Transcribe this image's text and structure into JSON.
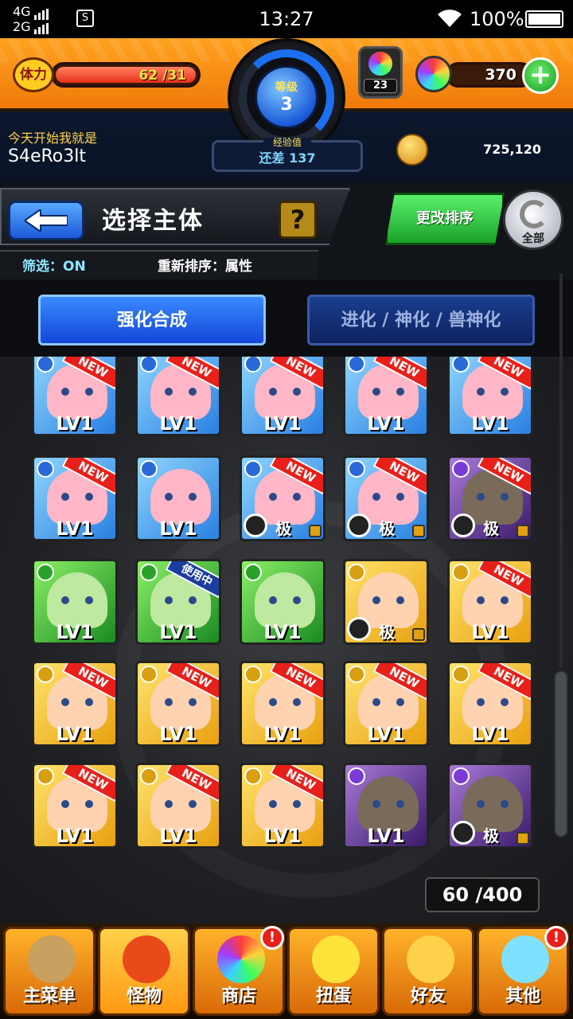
{
  "status": {
    "net1": "4G",
    "net2": "2G",
    "sim": "S",
    "time": "13:27",
    "battery": "100%"
  },
  "hud": {
    "stamina_label": "体力",
    "stamina_current": "62",
    "stamina_max": "/31",
    "level_label": "等级",
    "level": "3",
    "exp_label": "经验值",
    "exp_text": "还差 137",
    "egg_count": "23",
    "orbs": "370",
    "nick_caption": "今天开始我就是",
    "nick": "S4eRo3lt",
    "coins": "725,120"
  },
  "header": {
    "title": "选择主体",
    "help": "?",
    "filter": "筛选：ON",
    "sort": "重新排序：属性",
    "sort_button": "更改排序",
    "all_button": "全部"
  },
  "tabs": {
    "left": "强化合成",
    "right": "进化 / 神化 / 兽神化"
  },
  "monsters": [
    {
      "el": "water",
      "badge": "NEW",
      "lv": "LV1"
    },
    {
      "el": "water",
      "badge": "NEW",
      "lv": "LV1"
    },
    {
      "el": "water",
      "badge": "NEW",
      "lv": "LV1"
    },
    {
      "el": "water",
      "badge": "NEW",
      "lv": "LV1"
    },
    {
      "el": "water",
      "badge": "NEW",
      "lv": "LV1"
    },
    {
      "el": "water",
      "badge": "NEW",
      "lv": "LV1"
    },
    {
      "el": "water",
      "badge": "",
      "lv": "LV1"
    },
    {
      "el": "water",
      "badge": "NEW",
      "lv": "",
      "ji": "极"
    },
    {
      "el": "water",
      "badge": "NEW",
      "lv": "",
      "ji": "极"
    },
    {
      "el": "dark",
      "badge": "NEW",
      "lv": "",
      "ji": "极"
    },
    {
      "el": "wood",
      "badge": "",
      "lv": "LV1"
    },
    {
      "el": "wood",
      "badge": "使用中",
      "lv": "LV1"
    },
    {
      "el": "wood",
      "badge": "",
      "lv": "LV1"
    },
    {
      "el": "light",
      "badge": "",
      "lv": "",
      "ji": "极"
    },
    {
      "el": "light",
      "badge": "NEW",
      "lv": "LV1"
    },
    {
      "el": "light",
      "badge": "NEW",
      "lv": "LV1"
    },
    {
      "el": "light",
      "badge": "NEW",
      "lv": "LV1"
    },
    {
      "el": "light",
      "badge": "NEW",
      "lv": "LV1"
    },
    {
      "el": "light",
      "badge": "NEW",
      "lv": "LV1"
    },
    {
      "el": "light",
      "badge": "NEW",
      "lv": "LV1"
    },
    {
      "el": "light",
      "badge": "NEW",
      "lv": "LV1"
    },
    {
      "el": "light",
      "badge": "NEW",
      "lv": "LV1"
    },
    {
      "el": "light",
      "badge": "NEW",
      "lv": "LV1"
    },
    {
      "el": "dark",
      "badge": "",
      "lv": "LV1"
    },
    {
      "el": "dark",
      "badge": "",
      "lv": "",
      "ji": "极"
    }
  ],
  "box_count": "60 /400",
  "nav": [
    {
      "label": "主菜单",
      "icon": "house-icon",
      "alert": ""
    },
    {
      "label": "怪物",
      "icon": "monster-icon",
      "alert": ""
    },
    {
      "label": "商店",
      "icon": "orb-icon",
      "alert": "!"
    },
    {
      "label": "扭蛋",
      "icon": "egg-icon",
      "alert": ""
    },
    {
      "label": "好友",
      "icon": "friends-icon",
      "alert": ""
    },
    {
      "label": "其他",
      "icon": "other-icon",
      "alert": "!"
    }
  ]
}
